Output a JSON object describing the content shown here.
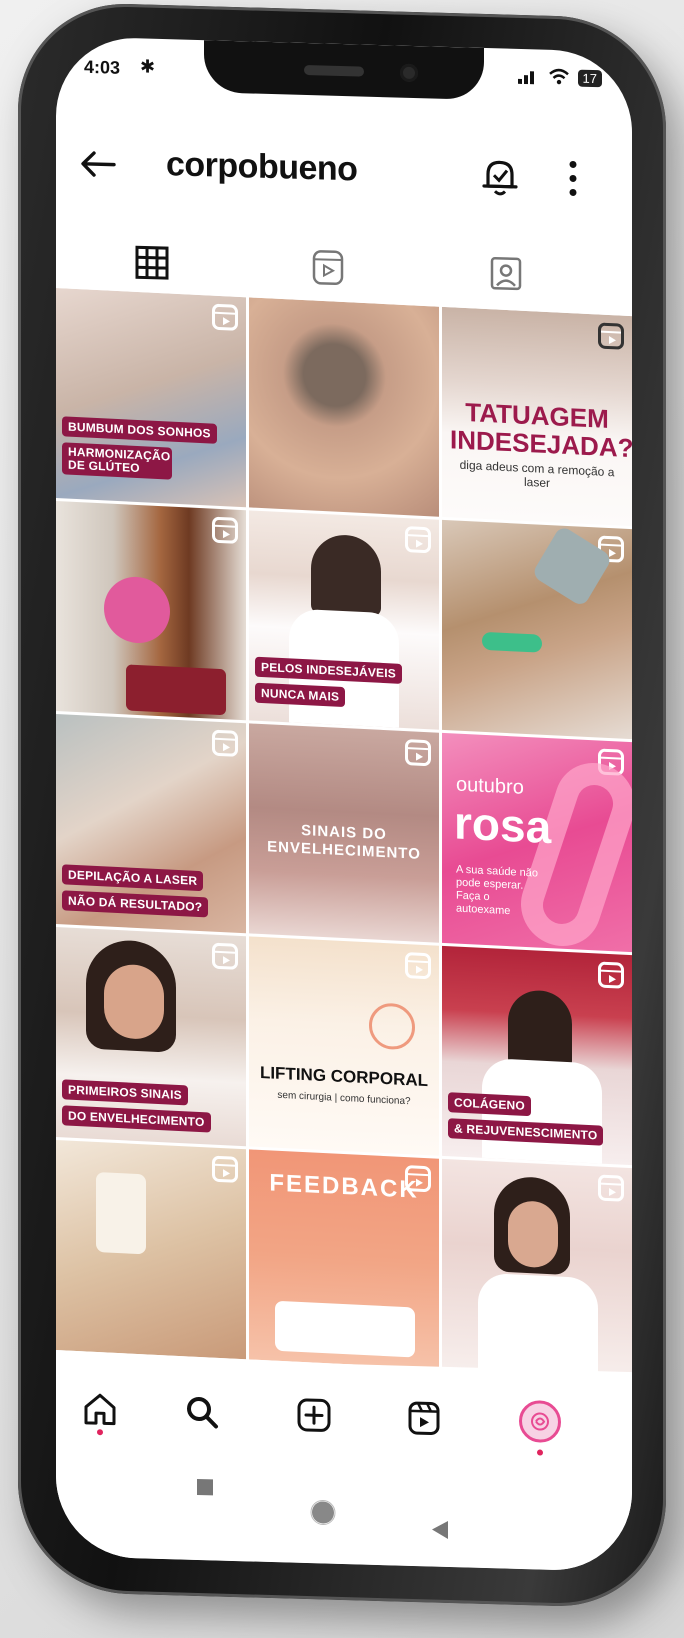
{
  "status": {
    "time": "4:03",
    "bluetooth": "✱",
    "battery": "17"
  },
  "profile": {
    "username": "corpobueno"
  },
  "icons": {
    "back": "arrow-left-icon",
    "bell": "bell-icon",
    "more": "more-vertical-icon",
    "grid": "grid-icon",
    "reels": "reels-icon",
    "tagged": "tagged-icon"
  },
  "colors": {
    "brand": "#8d1745",
    "pink": "#e84b93",
    "notification": "#e0245e"
  },
  "posts": [
    {
      "id": "p1",
      "tag1": "BUMBUM DOS SONHOS",
      "tag2": "HARMONIZAÇÃO DE GLÚTEO"
    },
    {
      "id": "p2"
    },
    {
      "id": "p3",
      "title": "TATUAGEM INDESEJADA?",
      "sub": "diga adeus com a remoção a laser"
    },
    {
      "id": "p4"
    },
    {
      "id": "p5",
      "tag1": "PELOS INDESEJÁVEIS",
      "tag2": "NUNCA MAIS"
    },
    {
      "id": "p6"
    },
    {
      "id": "p7",
      "tag1": "DEPILAÇÃO A LASER",
      "tag2": "NÃO DÁ RESULTADO?"
    },
    {
      "id": "p8",
      "title": "SINAIS DO ENVELHECIMENTO"
    },
    {
      "id": "p9",
      "outubro": "outubro",
      "rosa": "rosa",
      "body": "A sua saúde não pode esperar. Faça o autoexame"
    },
    {
      "id": "p10",
      "tag1": "PRIMEIROS SINAIS",
      "tag2": "DO ENVELHECIMENTO"
    },
    {
      "id": "p11",
      "title": "LIFTING CORPORAL",
      "sub": "sem cirurgia | como funciona?"
    },
    {
      "id": "p12",
      "tag1": "COLÁGENO",
      "tag2": "& REJUVENESCIMENTO"
    },
    {
      "id": "p13"
    },
    {
      "id": "p14",
      "title": "FEEDBACK"
    },
    {
      "id": "p15"
    }
  ]
}
